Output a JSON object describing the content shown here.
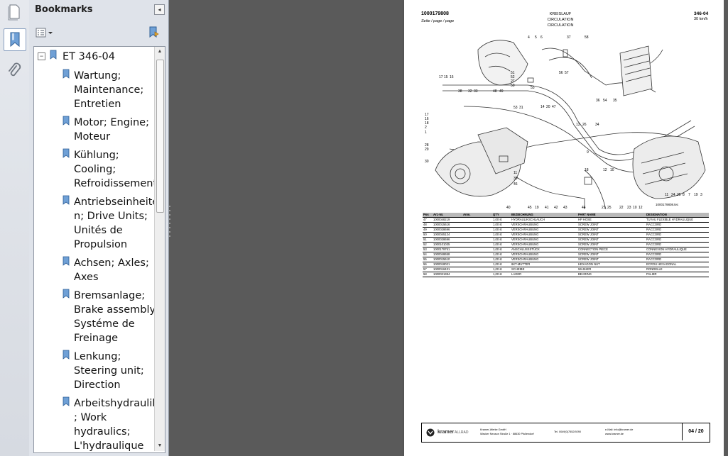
{
  "panel": {
    "title": "Bookmarks",
    "collapse_glyph": "◂"
  },
  "bookmarks": {
    "root": "ET 346-04",
    "items": [
      {
        "lines": [
          "Wartung;",
          "Maintenance;",
          "Entretien"
        ]
      },
      {
        "lines": [
          "Motor; Engine;",
          "Moteur"
        ]
      },
      {
        "lines": [
          "Kühlung;",
          "Cooling;",
          "Refroidissement"
        ]
      },
      {
        "lines": [
          "Antriebseinheite",
          "n; Drive Units;",
          "Unités de",
          "Propulsion"
        ]
      },
      {
        "lines": [
          "Achsen; Axles;",
          "Axes"
        ]
      },
      {
        "lines": [
          "Bremsanlage;",
          "Brake assembly;",
          "Systéme de",
          "Freinage"
        ]
      },
      {
        "lines": [
          "Lenkung;",
          "Steering unit;",
          "Direction"
        ]
      },
      {
        "lines": [
          "Arbeitshydraulik",
          "; Work",
          "hydraulics;",
          "L'hydraulique"
        ]
      }
    ]
  },
  "icons": {
    "pages": "pages-icon",
    "bookmarks": "bookmark-ribbon-icon",
    "attachments": "paperclip-icon",
    "options": "options-list-icon",
    "new_bookmark": "new-bookmark-icon"
  },
  "document": {
    "part_no": "1000179808",
    "page_label": "Seite / page / page",
    "title_lines": [
      "KREISLAUF",
      "CIRCULATION",
      "CIRCULATION"
    ],
    "doc_no": "346-04",
    "speed": "30 km/h",
    "figure_ref": "1000179808.tec",
    "table": {
      "headers": [
        "Pos",
        "Art.-Nr.",
        "Anm.",
        "QTY",
        "BEZEICHNUNG",
        "PART NAME",
        "DESIGNATION"
      ],
      "rows": [
        [
          "47",
          "1000048219",
          "",
          "1,00 st",
          "HYDRAULIKSCHLAUCH",
          "HP HOSE",
          "TUYAU FLEXIBLE HYDRAULIQUE"
        ],
        [
          "48",
          "1000015616",
          "",
          "1,00 st",
          "VERSCHRAUBUNG",
          "SCREW JOINT",
          "RACCORD"
        ],
        [
          "49",
          "1000028696",
          "",
          "1,00 st",
          "VERSCHRAUBUNG",
          "SCREW JOINT",
          "RACCORD"
        ],
        [
          "50",
          "1000045124",
          "",
          "1,00 st",
          "VERSCHRAUBUNG",
          "SCREW JOINT",
          "RACCORD"
        ],
        [
          "51",
          "1000028696",
          "",
          "1,00 st",
          "VERSCHRAUBUNG",
          "SCREW JOINT",
          "RACCORD"
        ],
        [
          "52",
          "1000101035",
          "",
          "1,00 st",
          "VERSCHRAUBUNG",
          "SCREW JOINT",
          "RACCORD"
        ],
        [
          "53",
          "1000179751",
          "",
          "1,00 st",
          "ANSCHLUSSSTÜCK",
          "CONNECTION PIECE",
          "CONNEXION HYDRAULIQUE"
        ],
        [
          "54",
          "1000048658",
          "",
          "1,00 st",
          "VERSCHRAUBUNG",
          "SCREW JOINT",
          "RACCORD"
        ],
        [
          "55",
          "1000015610",
          "",
          "1,00 st",
          "VERSCHRAUBUNG",
          "SCREW JOINT",
          "RACCORD"
        ],
        [
          "56",
          "1000018021",
          "",
          "1,00 st",
          "6KT-MUTTER",
          "HEXAGON NUT",
          "ECROU HEXAGONAL"
        ],
        [
          "57",
          "1000016431",
          "",
          "1,00 st",
          "SCHEIBE",
          "WASHER",
          "RONDELLE"
        ],
        [
          "58",
          "1000021384",
          "",
          "1,00 st",
          "LAGER",
          "BEARING",
          "PALIER"
        ]
      ]
    },
    "footer": {
      "brand": "kramer",
      "brand_suffix": "ALLRAD",
      "company_line1": "Kramer-Werke GmbH",
      "company_line2": "Wacker Neuson Straße 1 · 88630 Pfullendorf",
      "phone": "Tel. 0049(0)7552/9290",
      "email": "e-Mail: info@kramer.de",
      "web": "www.kramer.de",
      "page": "04 / 20"
    }
  },
  "callouts": [
    "4",
    "5",
    "6",
    "37",
    "58",
    "17",
    "15",
    "16",
    "51",
    "52",
    "27",
    "50",
    "56",
    "57",
    "38",
    "32",
    "33",
    "48",
    "49",
    "55",
    "53",
    "31",
    "14",
    "20",
    "47",
    "36",
    "54",
    "35",
    "17",
    "16",
    "18",
    "2",
    "1",
    "13",
    "26",
    "34",
    "28",
    "29",
    "30",
    "9",
    "18",
    "12",
    "10",
    "11",
    "39",
    "46",
    "40",
    "45",
    "19",
    "41",
    "42",
    "43",
    "44",
    "21",
    "25",
    "22",
    "23",
    "10",
    "12",
    "11",
    "24",
    "25",
    "8",
    "7",
    "19",
    "3"
  ]
}
